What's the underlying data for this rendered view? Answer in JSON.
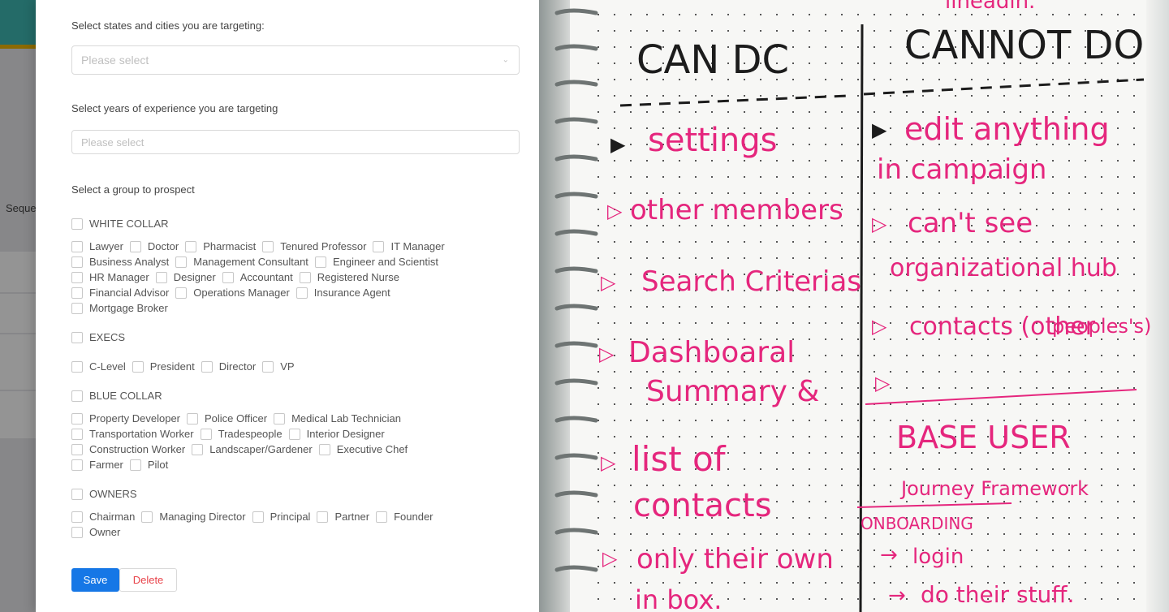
{
  "background_app": {
    "sidebar_fragment": "Seque"
  },
  "form": {
    "states_label": "Select states and cities you are targeting:",
    "states_placeholder": "Please select",
    "experience_label": "Select years of experience you are targeting",
    "experience_placeholder": "Please select",
    "group_label": "Select a group to prospect",
    "groups": {
      "white_collar": {
        "title": "WHITE COLLAR",
        "rows": [
          [
            "Lawyer",
            "Doctor",
            "Pharmacist",
            "Tenured Professor",
            "IT Manager"
          ],
          [
            "Business Analyst",
            "Management Consultant",
            "Engineer and Scientist"
          ],
          [
            "HR Manager",
            "Designer",
            "Accountant",
            "Registered Nurse"
          ],
          [
            "Financial Advisor",
            "Operations Manager",
            "Insurance Agent"
          ],
          [
            "Mortgage Broker"
          ]
        ]
      },
      "execs": {
        "title": "EXECS",
        "rows": [
          [
            "C-Level",
            "President",
            "Director",
            "VP"
          ]
        ]
      },
      "blue_collar": {
        "title": "BLUE COLLAR",
        "rows": [
          [
            "Property Developer",
            "Police Officer",
            "Medical Lab Technician"
          ],
          [
            "Transportation Worker",
            "Tradespeople",
            "Interior Designer"
          ],
          [
            "Construction Worker",
            "Landscaper/Gardener",
            "Executive Chef"
          ],
          [
            "Farmer",
            "Pilot"
          ]
        ]
      },
      "owners": {
        "title": "OWNERS",
        "rows": [
          [
            "Chairman",
            "Managing Director",
            "Principal",
            "Partner",
            "Founder"
          ],
          [
            "Owner"
          ]
        ]
      }
    },
    "save_label": "Save",
    "delete_label": "Delete",
    "colors": {
      "primary": "#1677e6",
      "danger": "#e8434a"
    }
  },
  "notebook": {
    "top_fragment": "lineadin.",
    "can_do_heading": "CAN DC",
    "cannot_do_heading": "CANNOT DO",
    "can_do": [
      "settings",
      "other members",
      "Search Criterias",
      "Dashboaral",
      "Summary &",
      "list of",
      "contacts",
      "only their own",
      "in box."
    ],
    "cannot_do": [
      "edit anything",
      "in campaign",
      "can't see",
      "organizational hub",
      "contacts (other",
      "peoples's)"
    ],
    "base_user": "BASE USER",
    "journey": "Journey Framework",
    "onboarding": "ONBOARDING",
    "steps": [
      "login",
      "do their stuff."
    ],
    "colors": {
      "ink_black": "#1c1c1c",
      "ink_pink": "#e5267d"
    }
  }
}
